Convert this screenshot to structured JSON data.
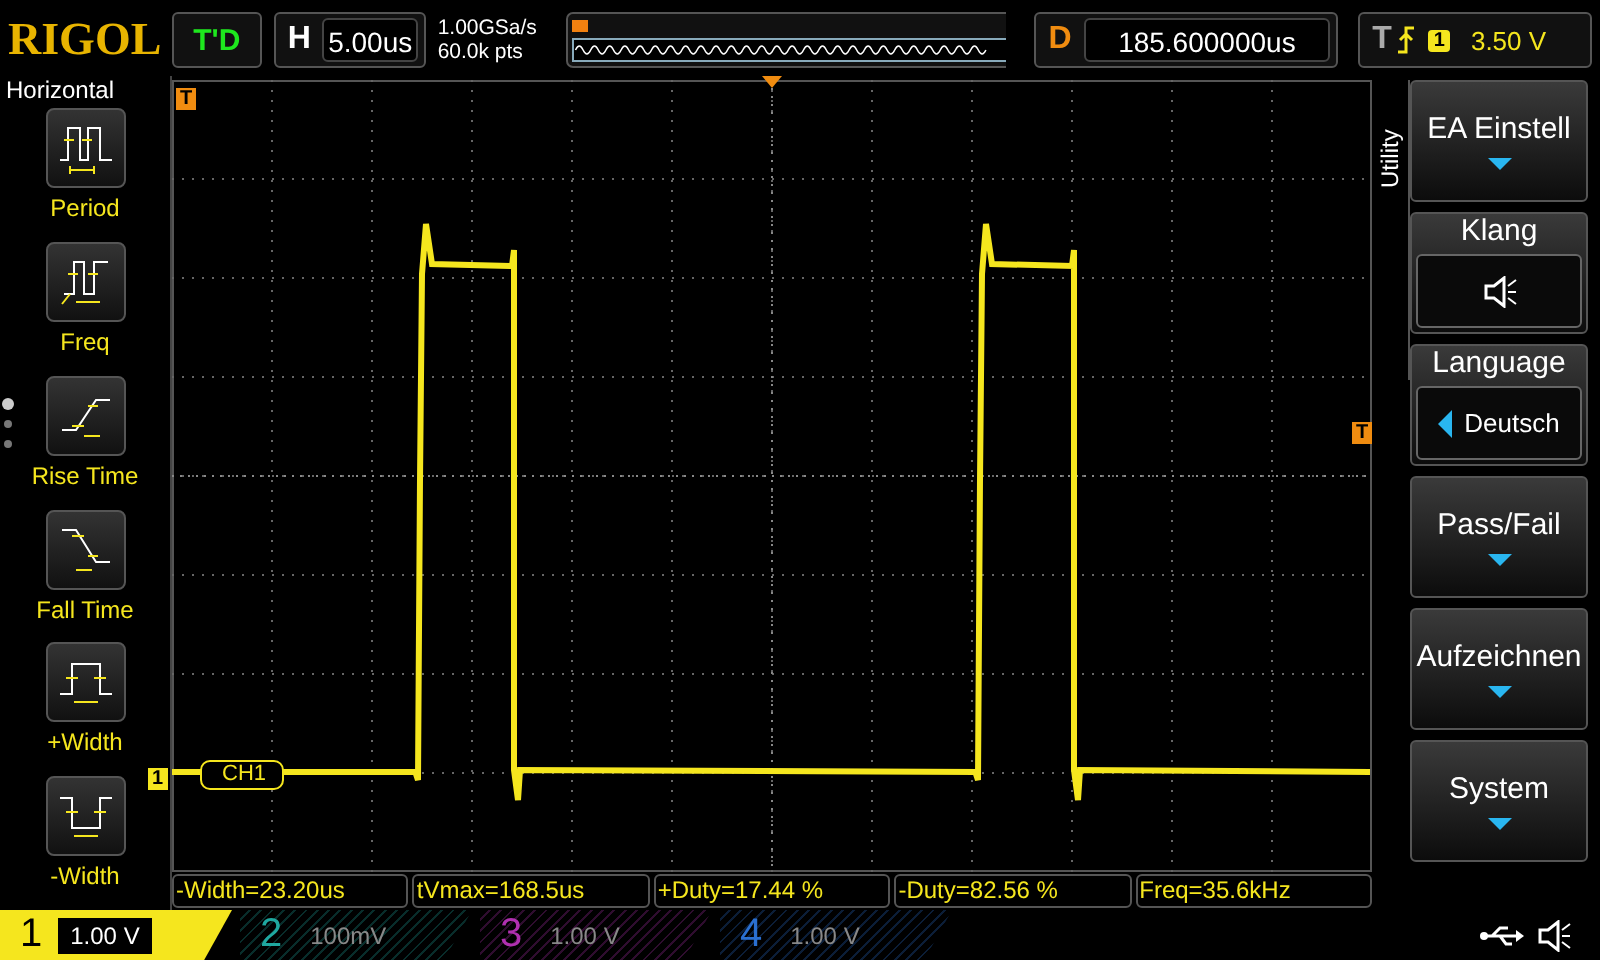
{
  "brand": "RIGOL",
  "trigger_status": "T'D",
  "horizontal": {
    "label": "H",
    "timebase": "5.00us"
  },
  "sample_rate": "1.00GSa/s",
  "memory_depth": "60.0k pts",
  "delay": {
    "label": "D",
    "value": "185.600000us"
  },
  "trigger": {
    "label": "T",
    "channel": "1",
    "level": "3.50 V"
  },
  "left_menu": {
    "title": "Horizontal",
    "items": [
      {
        "kind": "period",
        "label": "Period"
      },
      {
        "kind": "freq",
        "label": "Freq"
      },
      {
        "kind": "rise",
        "label": "Rise Time"
      },
      {
        "kind": "fall",
        "label": "Fall Time"
      },
      {
        "kind": "pwidth",
        "label": "+Width"
      },
      {
        "kind": "nwidth",
        "label": "-Width"
      }
    ]
  },
  "scope": {
    "trigger_marker": "T",
    "channel_marker": "1",
    "channel_label": "CH1",
    "level_marker": "T"
  },
  "right_menu": {
    "title": "Utility",
    "items": [
      {
        "kind": "button",
        "label": "EA Einstell"
      },
      {
        "kind": "icon",
        "label": "Klang"
      },
      {
        "kind": "select",
        "label": "Language",
        "value": "Deutsch"
      },
      {
        "kind": "button",
        "label": "Pass/Fail"
      },
      {
        "kind": "button",
        "label": "Aufzeichnen"
      },
      {
        "kind": "button",
        "label": "System"
      }
    ]
  },
  "measurements": [
    "-Width=23.20us",
    "tVmax=168.5us",
    "+Duty=17.44 %",
    "-Duty=82.56 %",
    "Freq=35.6kHz"
  ],
  "channels": [
    {
      "number": "1",
      "scale": "1.00 V",
      "selected": true,
      "color": "#f5e61e"
    },
    {
      "number": "2",
      "scale": "100mV",
      "selected": false,
      "color": "#1fa8a0"
    },
    {
      "number": "3",
      "scale": "1.00 V",
      "selected": false,
      "color": "#b030b0"
    },
    {
      "number": "4",
      "scale": "1.00 V",
      "selected": false,
      "color": "#2a6fd0"
    }
  ]
}
